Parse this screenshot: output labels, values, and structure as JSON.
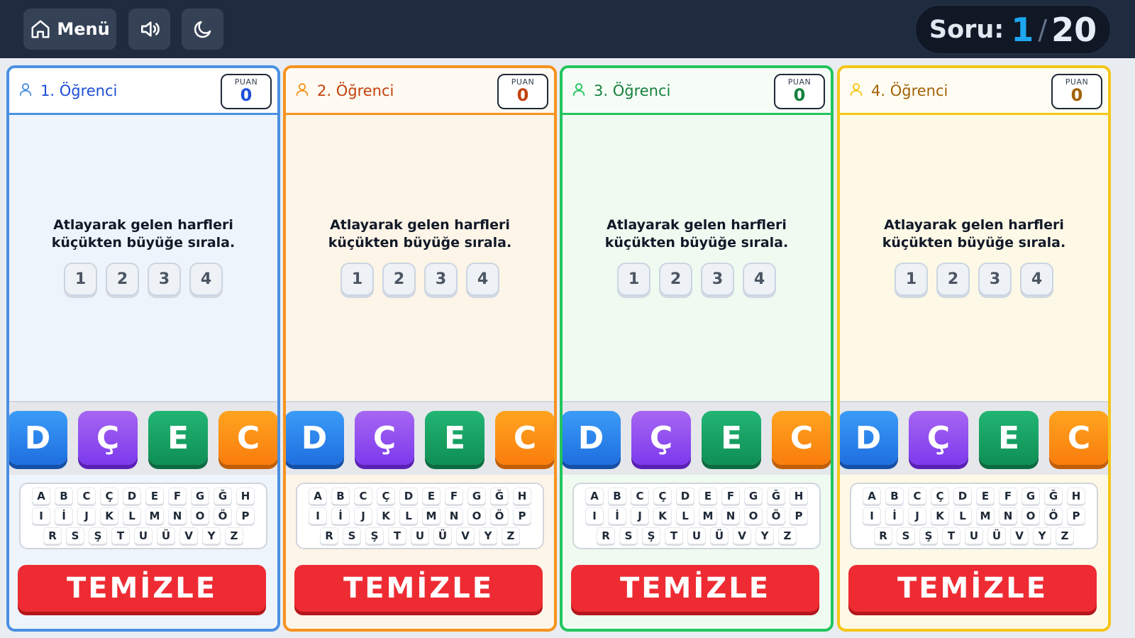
{
  "topbar": {
    "menu_label": "Menü",
    "question_label": "Soru:",
    "question_current": "1",
    "question_separator": "/",
    "question_total": "20"
  },
  "players": [
    {
      "name": "1. Öğrenci",
      "score_label": "PUAN",
      "score": "0",
      "color": "#4a90e2",
      "name_color": "#1d4ed8",
      "score_color": "#1d4ed8",
      "bg": "#eef4fb",
      "head_bg": "#ffffff"
    },
    {
      "name": "2. Öğrenci",
      "score_label": "PUAN",
      "score": "0",
      "color": "#f7931e",
      "name_color": "#c2410c",
      "score_color": "#c2410c",
      "bg": "#fdf5e8",
      "head_bg": "#fffaf2"
    },
    {
      "name": "3. Öğrenci",
      "score_label": "PUAN",
      "score": "0",
      "color": "#22c55e",
      "name_color": "#15803d",
      "score_color": "#15803d",
      "bg": "#effbf1",
      "head_bg": "#f6fdf7"
    },
    {
      "name": "4. Öğrenci",
      "score_label": "PUAN",
      "score": "0",
      "color": "#f5c518",
      "name_color": "#a16207",
      "score_color": "#a16207",
      "bg": "#fdf9e6",
      "head_bg": "#fffdf3"
    }
  ],
  "question": {
    "line1": "Atlayarak gelen harfleri",
    "line2": "küçükten büyüğe sırala.",
    "slots": [
      "1",
      "2",
      "3",
      "4"
    ]
  },
  "tiles": [
    {
      "letter": "D",
      "color": "blue"
    },
    {
      "letter": "Ç",
      "color": "purple"
    },
    {
      "letter": "E",
      "color": "green"
    },
    {
      "letter": "C",
      "color": "orange"
    }
  ],
  "keyboard": {
    "rows": [
      [
        "A",
        "B",
        "C",
        "Ç",
        "D",
        "E",
        "F",
        "G",
        "Ğ",
        "H"
      ],
      [
        "I",
        "İ",
        "J",
        "K",
        "L",
        "M",
        "N",
        "O",
        "Ö",
        "P"
      ],
      [
        "R",
        "S",
        "Ş",
        "T",
        "U",
        "Ü",
        "V",
        "Y",
        "Z"
      ]
    ]
  },
  "clear_label": "TEMİZLE"
}
